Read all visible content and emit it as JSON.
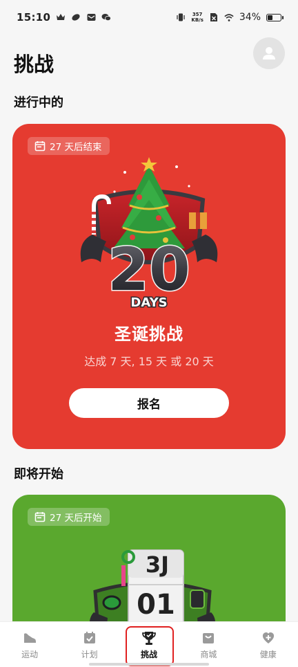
{
  "status_bar": {
    "time": "15:10",
    "net_speed_value": "357",
    "net_speed_unit": "KB/s",
    "battery_percent": "34%",
    "battery_level": 0.34
  },
  "header": {
    "title": "挑战"
  },
  "sections": {
    "in_progress": "进行中的",
    "upcoming": "即将开始"
  },
  "active_card": {
    "badge_text": "27 天后结束",
    "art_number": "20",
    "art_caption": "DAYS",
    "title": "圣诞挑战",
    "subtitle": "达成 7 天, 15 天 或 20 天",
    "button_label": "报名",
    "color": "#e53b30"
  },
  "upcoming_card": {
    "badge_text": "27 天后开始",
    "art_month": "3J",
    "art_day": "01",
    "color": "#5aa82e"
  },
  "bottom_nav": {
    "items": [
      {
        "label": "运动",
        "icon": "shoe-icon"
      },
      {
        "label": "计划",
        "icon": "plan-icon"
      },
      {
        "label": "挑战",
        "icon": "trophy-icon"
      },
      {
        "label": "商城",
        "icon": "shop-icon"
      },
      {
        "label": "健康",
        "icon": "health-icon"
      }
    ],
    "active_index": 2
  }
}
